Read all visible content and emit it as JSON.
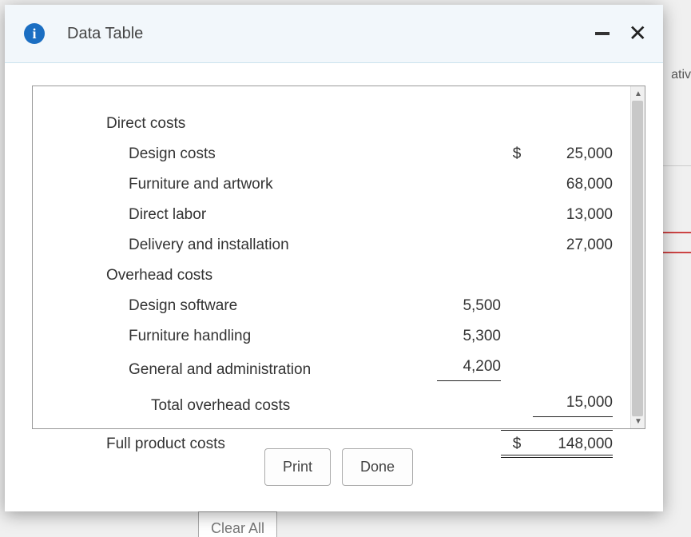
{
  "header": {
    "title": "Data Table"
  },
  "bg": {
    "text_fragment": "ativ",
    "clear_all": "Clear All"
  },
  "chart_data": {
    "type": "table",
    "title": "Data Table",
    "sections": [
      {
        "name": "Direct costs",
        "items": [
          {
            "label": "Design costs",
            "value": 25000,
            "currency": "$"
          },
          {
            "label": "Furniture and artwork",
            "value": 68000
          },
          {
            "label": "Direct labor",
            "value": 13000
          },
          {
            "label": "Delivery and installation",
            "value": 27000
          }
        ]
      },
      {
        "name": "Overhead costs",
        "items": [
          {
            "label": "Design software",
            "value": 5500
          },
          {
            "label": "Furniture handling",
            "value": 5300
          },
          {
            "label": "General and administration",
            "value": 4200
          }
        ],
        "subtotal": {
          "label": "Total overhead costs",
          "value": 15000
        }
      }
    ],
    "total": {
      "label": "Full product costs",
      "value": 148000,
      "currency": "$"
    }
  },
  "display": {
    "direct_costs_heading": "Direct costs",
    "design_costs": "Design costs",
    "design_costs_sym": "$",
    "design_costs_val": "25,000",
    "furniture_artwork": "Furniture and artwork",
    "furniture_artwork_val": "68,000",
    "direct_labor": "Direct labor",
    "direct_labor_val": "13,000",
    "delivery_install": "Delivery and installation",
    "delivery_install_val": "27,000",
    "overhead_heading": "Overhead costs",
    "design_software": "Design software",
    "design_software_val": "5,500",
    "furniture_handling": "Furniture handling",
    "furniture_handling_val": "5,300",
    "gen_admin": "General and administration",
    "gen_admin_val": "4,200",
    "total_overhead": "Total overhead costs",
    "total_overhead_val": "15,000",
    "full_product": "Full product costs",
    "full_product_sym": "$",
    "full_product_val": "148,000"
  },
  "buttons": {
    "print": "Print",
    "done": "Done"
  }
}
